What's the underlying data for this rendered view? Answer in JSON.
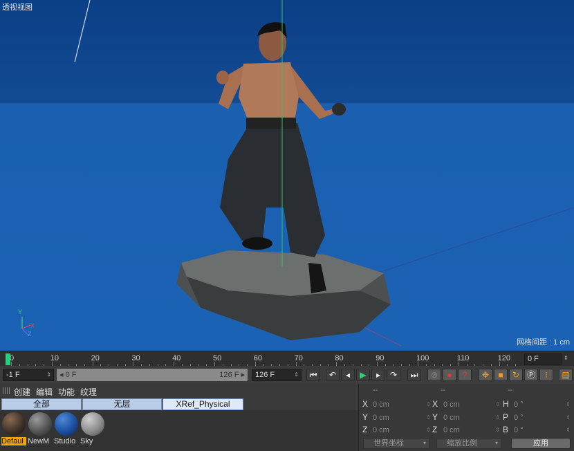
{
  "viewport": {
    "title": "透视视图",
    "grid_spacing": "网格间距 : 1 cm",
    "axis_labels": {
      "y": "Y",
      "x": "X",
      "z": "Z"
    }
  },
  "timeline": {
    "ticks": [
      "0",
      "10",
      "20",
      "30",
      "40",
      "50",
      "60",
      "70",
      "80",
      "90",
      "100",
      "110",
      "120"
    ],
    "current_frame": "0 F"
  },
  "transport": {
    "start_field": "-1 F",
    "range_start": "0 F",
    "range_end": "126 F",
    "end_field": "126 F"
  },
  "material_manager": {
    "menu": [
      "创建",
      "编辑",
      "功能",
      "纹理"
    ],
    "tabs": [
      "全部",
      "无层",
      "XRef_Physical Render"
    ],
    "materials": [
      {
        "label": "Defaul",
        "selected": true,
        "color": "#3a2e26"
      },
      {
        "label": "NewM",
        "selected": false,
        "color": "#555555"
      },
      {
        "label": "Studio",
        "selected": false,
        "color": "#1b4fa0"
      },
      {
        "label": "Sky",
        "selected": false,
        "color": "#8c8c8c"
      }
    ]
  },
  "coordinates": {
    "headers": [
      "--",
      "--",
      "--"
    ],
    "rows": [
      {
        "a1": "X",
        "v1": "0 cm",
        "a2": "X",
        "v2": "0 cm",
        "a3": "H",
        "v3": "0 °"
      },
      {
        "a1": "Y",
        "v1": "0 cm",
        "a2": "Y",
        "v2": "0 cm",
        "a3": "P",
        "v3": "0 °"
      },
      {
        "a1": "Z",
        "v1": "0 cm",
        "a2": "Z",
        "v2": "0 cm",
        "a3": "B",
        "v3": "0 °"
      }
    ],
    "mode_select": "世界坐标",
    "scale_select": "缩放比例",
    "apply": "应用"
  },
  "colors": {
    "viewport_bg": "#1c62b4",
    "playhead": "#1fd27b",
    "selected_material": "#f2a700"
  }
}
